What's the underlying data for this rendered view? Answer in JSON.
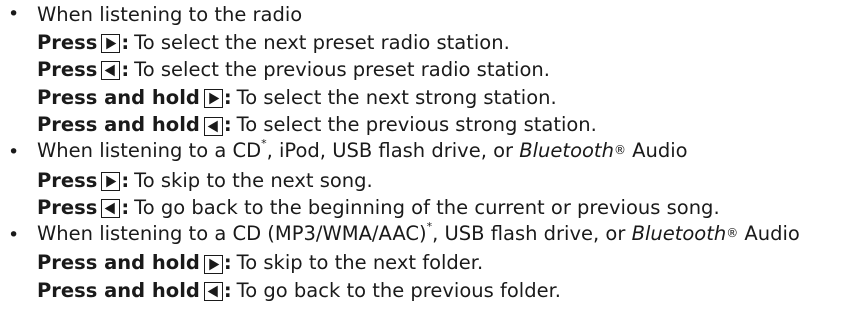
{
  "sections": [
    {
      "heading_prefix": "When listening to the radio",
      "items": [
        {
          "press": "Press",
          "icon": "right-arrow-icon",
          "text": "To select the next preset radio station."
        },
        {
          "press": "Press",
          "icon": "left-arrow-icon",
          "text": "To select the previous preset radio station."
        },
        {
          "press": "Press and hold",
          "icon": "right-arrow-icon",
          "text": "To select the next strong station."
        },
        {
          "press": "Press and hold",
          "icon": "left-arrow-icon",
          "text": "To select the previous strong station."
        }
      ]
    },
    {
      "heading_prefix": "When listening to a CD",
      "heading_mid": ", iPod, USB flash drive, or ",
      "heading_italic": "Bluetooth",
      "heading_suffix": " Audio",
      "items": [
        {
          "press": "Press",
          "icon": "right-arrow-icon",
          "text": "To skip to the next song."
        },
        {
          "press": "Press",
          "icon": "left-arrow-icon",
          "text": "To go back to the beginning of the current or previous song."
        }
      ]
    },
    {
      "heading_prefix": "When listening to a CD (MP3/WMA/AAC)",
      "heading_mid": ", USB flash drive, or ",
      "heading_italic": "Bluetooth",
      "heading_suffix": " Audio",
      "items": [
        {
          "press": "Press and hold",
          "icon": "right-arrow-icon",
          "text": "To skip to the next folder."
        },
        {
          "press": "Press and hold",
          "icon": "left-arrow-icon",
          "text": "To go back to the previous folder."
        }
      ]
    }
  ],
  "symbols": {
    "bullet": "•",
    "colon": ":",
    "asterisk": "*",
    "registered": "®"
  }
}
